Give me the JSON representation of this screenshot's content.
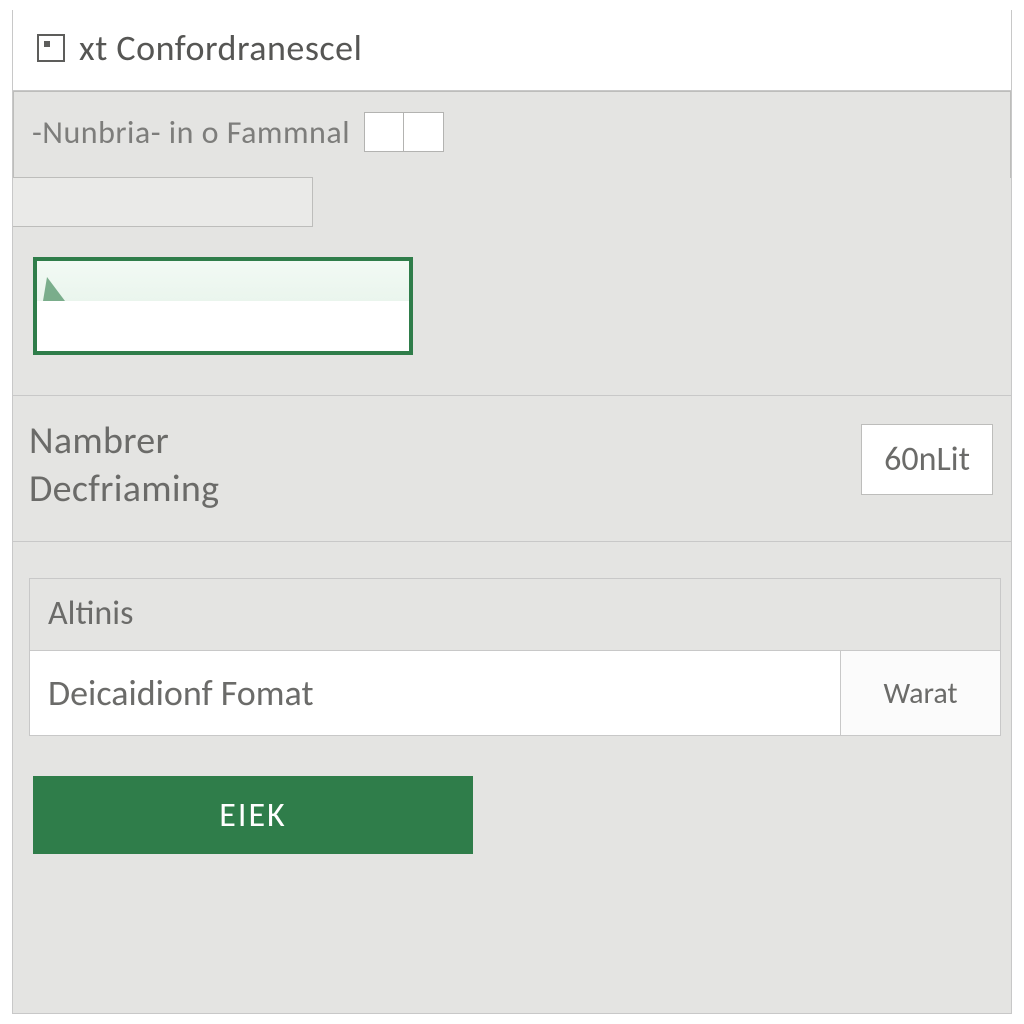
{
  "colors": {
    "accent": "#2f7d4a",
    "panel": "#e4e4e2"
  },
  "titlebar": {
    "title": "xt Confordranescel"
  },
  "group1": {
    "legend": "-Nunbria- in о  Fammnal",
    "box1": "",
    "box2": ""
  },
  "preview": {
    "value": ""
  },
  "mid": {
    "line1": "Nambrer",
    "line2": "Decfriaming",
    "button": "60nLit"
  },
  "low": {
    "header": "Altinis",
    "row_label": "Deicaidionf Fomat",
    "row_value": "Warat"
  },
  "primary": {
    "label": "EIEK"
  }
}
